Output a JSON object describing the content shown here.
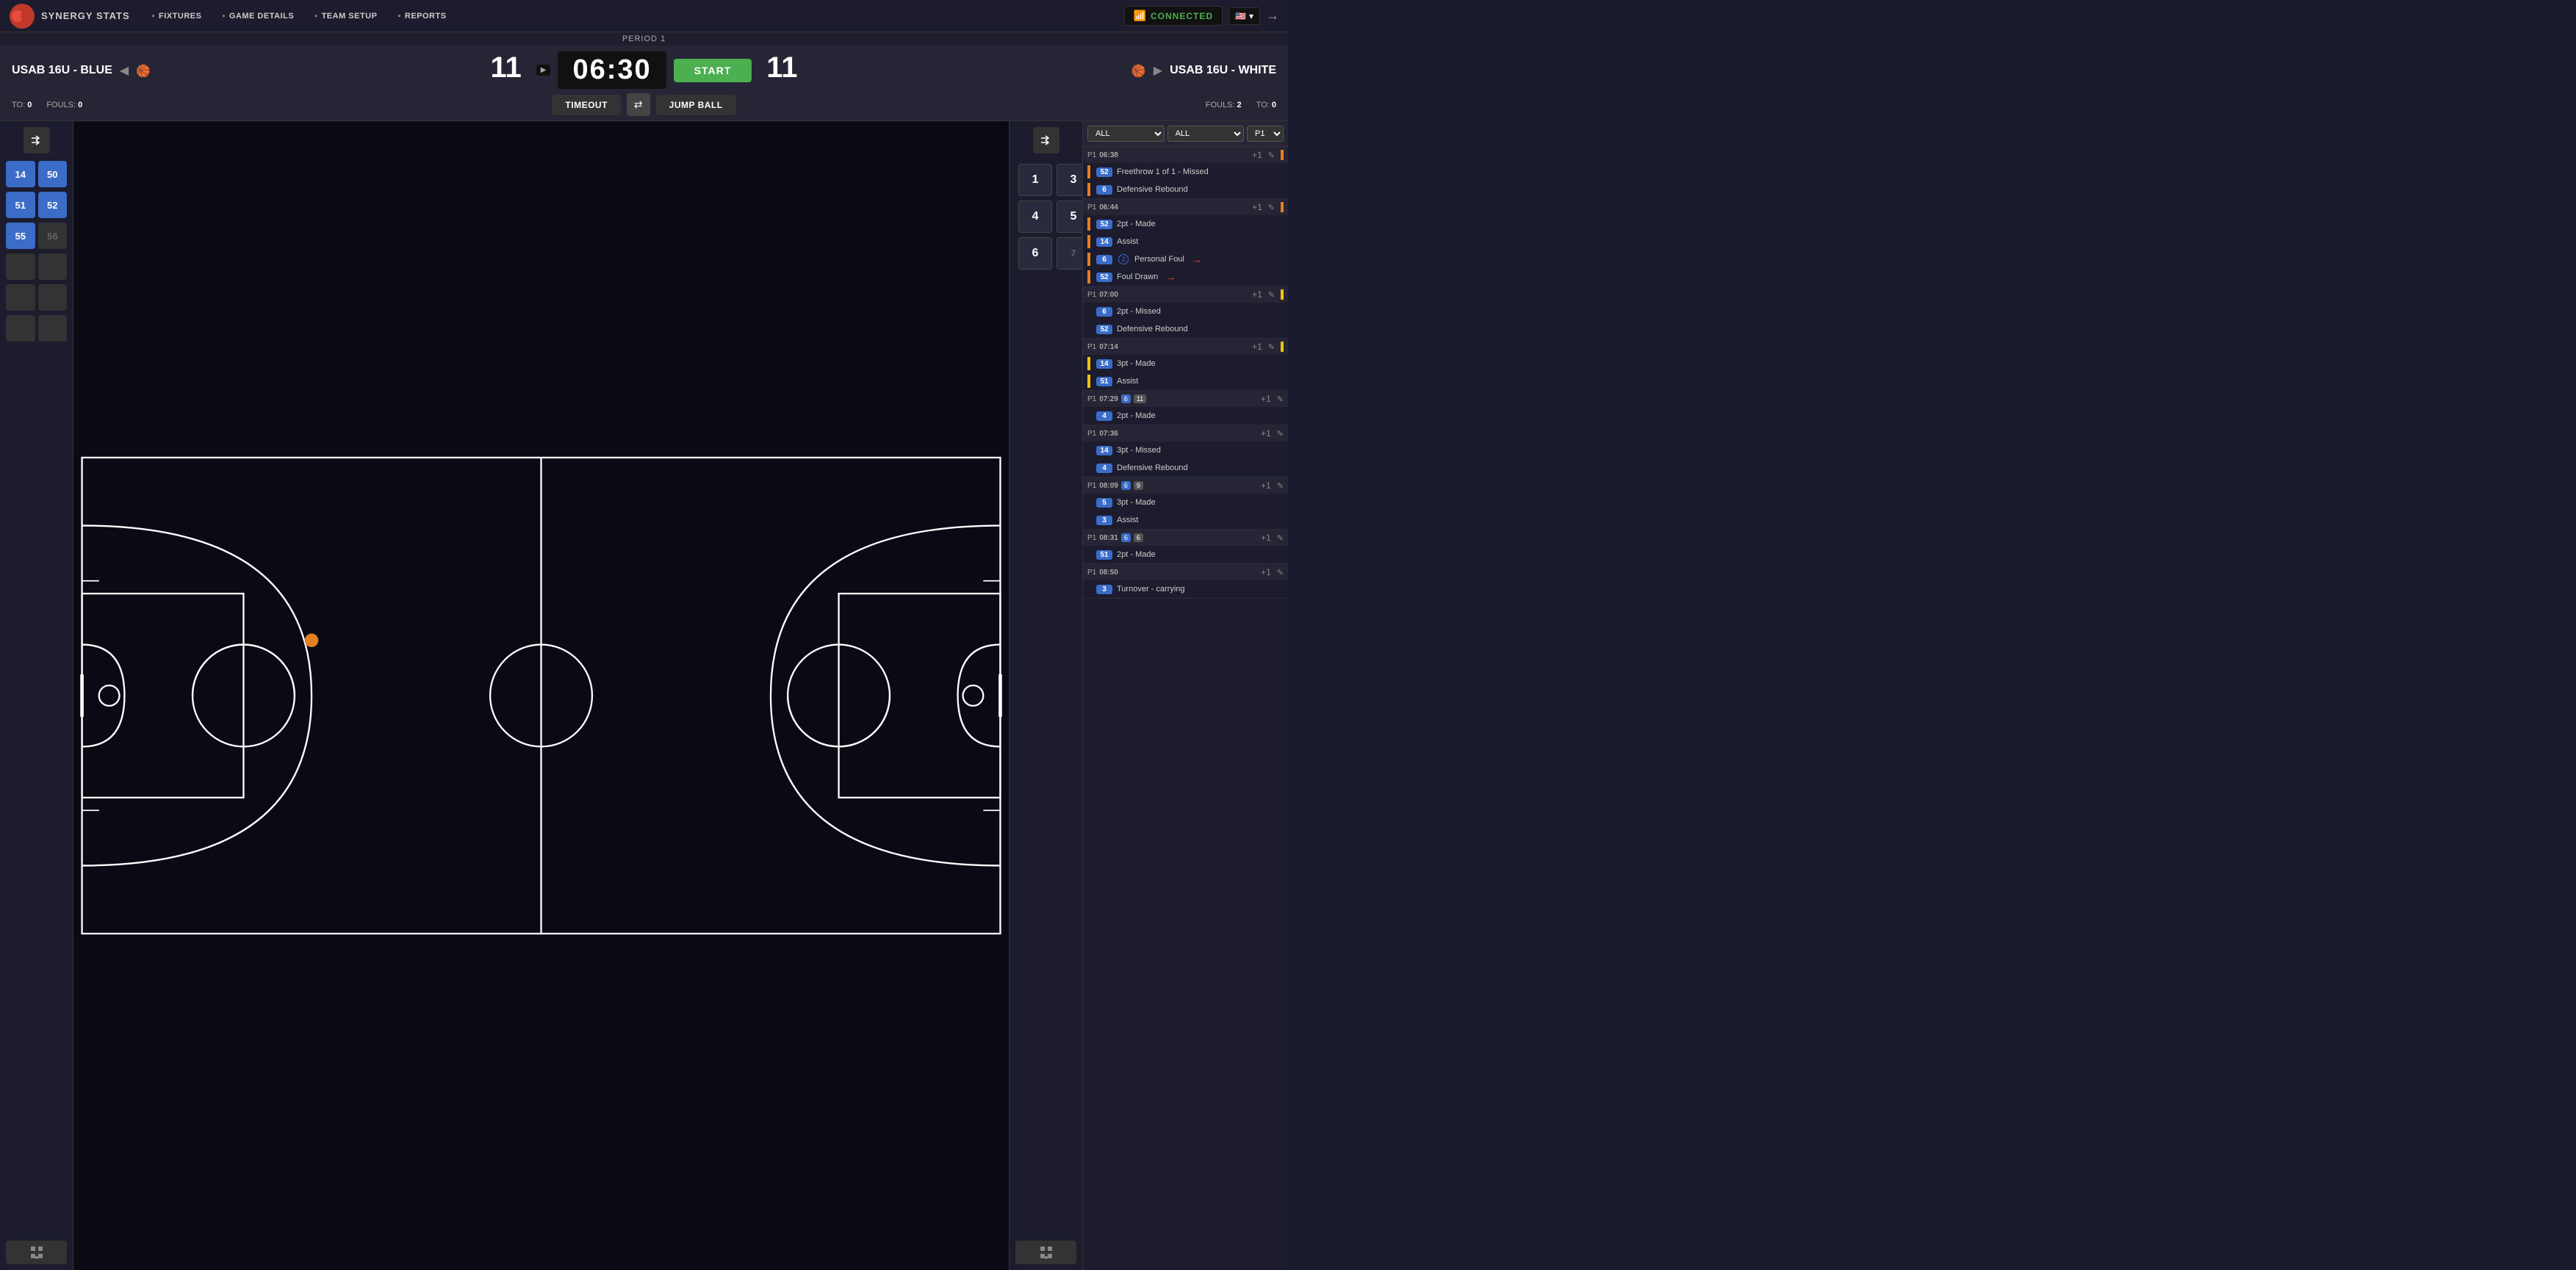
{
  "app": {
    "logo_text": "SYNERGY STATS",
    "nav_items": [
      "FIXTURES",
      "GAME DETAILS",
      "TEAM SETUP",
      "REPORTS"
    ]
  },
  "connection": {
    "status": "CONNECTED",
    "label": "CONNECTED"
  },
  "scoreboard": {
    "period": "PERIOD 1",
    "timer": "06:30",
    "team_left": {
      "name": "USAB 16U - BLUE",
      "score": "11",
      "fouls": "0",
      "timeouts": "0"
    },
    "team_right": {
      "name": "USAB 16U - WHITE",
      "score": "11",
      "fouls": "2",
      "timeouts": "0"
    },
    "start_btn": "START",
    "timeout_btn": "TIMEOUT",
    "jumpball_btn": "JUMP BALL",
    "fouls_label": "FOULS:",
    "to_label": "TO:"
  },
  "roster_left": {
    "players": [
      {
        "number": "14",
        "active": true
      },
      {
        "number": "50",
        "active": true
      },
      {
        "number": "51",
        "active": true
      },
      {
        "number": "52",
        "active": true
      },
      {
        "number": "55",
        "active": true
      },
      {
        "number": "56",
        "active": false
      }
    ],
    "empty_slots": 6
  },
  "roster_right": {
    "numbers": [
      "1",
      "3",
      "4",
      "5",
      "6",
      "7"
    ],
    "empty": false
  },
  "play_log": {
    "filter_all1": "ALL",
    "filter_all2": "ALL",
    "filter_p1": "P1",
    "groups": [
      {
        "id": "g1",
        "period": "P1",
        "time": "06:38",
        "sidebar_color": "orange",
        "actions": [
          {
            "num": "52",
            "action": "Freethrow 1 of 1 - Missed",
            "sidebar": "orange"
          },
          {
            "num": "6",
            "action": "Defensive Rebound",
            "sidebar": "orange"
          }
        ]
      },
      {
        "id": "g2",
        "period": "P1",
        "time": "06:44",
        "sidebar_color": "orange",
        "actions": [
          {
            "num": "52",
            "action": "2pt - Made",
            "sidebar": "orange"
          },
          {
            "num": "14",
            "action": "Assist",
            "sidebar": "orange"
          },
          {
            "num": "6",
            "action": "Personal Foul",
            "sidebar": "orange",
            "badge": "2",
            "has_arrow": true
          },
          {
            "num": "52",
            "action": "Foul Drawn",
            "sidebar": "orange",
            "has_arrow": true
          }
        ]
      },
      {
        "id": "g3",
        "period": "P1",
        "time": "07:00",
        "sidebar_color": "hidden",
        "actions": [
          {
            "num": "6",
            "action": "2pt - Missed",
            "sidebar": "hidden"
          },
          {
            "num": "52",
            "action": "Defensive Rebound",
            "sidebar": "hidden"
          }
        ]
      },
      {
        "id": "g4",
        "period": "P1",
        "time": "07:14",
        "sidebar_color": "yellow",
        "actions": [
          {
            "num": "14",
            "action": "3pt - Made",
            "sidebar": "yellow"
          },
          {
            "num": "51",
            "action": "Assist",
            "sidebar": "yellow"
          }
        ]
      },
      {
        "id": "g5",
        "period": "P1",
        "time": "07:29",
        "badge1": "6",
        "badge2": "11",
        "sidebar_color": "hidden",
        "actions": [
          {
            "num": "4",
            "action": "2pt - Made",
            "sidebar": "hidden"
          }
        ]
      },
      {
        "id": "g6",
        "period": "P1",
        "time": "07:36",
        "sidebar_color": "hidden",
        "actions": [
          {
            "num": "14",
            "action": "3pt - Missed",
            "sidebar": "hidden"
          },
          {
            "num": "4",
            "action": "Defensive Rebound",
            "sidebar": "hidden"
          }
        ]
      },
      {
        "id": "g7",
        "period": "P1",
        "time": "08:09",
        "badge1": "6",
        "badge2": "9",
        "sidebar_color": "hidden",
        "actions": [
          {
            "num": "5",
            "action": "3pt - Made",
            "sidebar": "hidden"
          },
          {
            "num": "3",
            "action": "Assist",
            "sidebar": "hidden"
          }
        ]
      },
      {
        "id": "g8",
        "period": "P1",
        "time": "08:31",
        "badge1": "6",
        "badge2": "6",
        "sidebar_color": "hidden",
        "actions": [
          {
            "num": "51",
            "action": "2pt - Made",
            "sidebar": "hidden"
          }
        ]
      },
      {
        "id": "g9",
        "period": "P1",
        "time": "08:50",
        "sidebar_color": "hidden",
        "actions": [
          {
            "num": "3",
            "action": "Turnover - carrying",
            "sidebar": "hidden"
          }
        ]
      }
    ]
  }
}
